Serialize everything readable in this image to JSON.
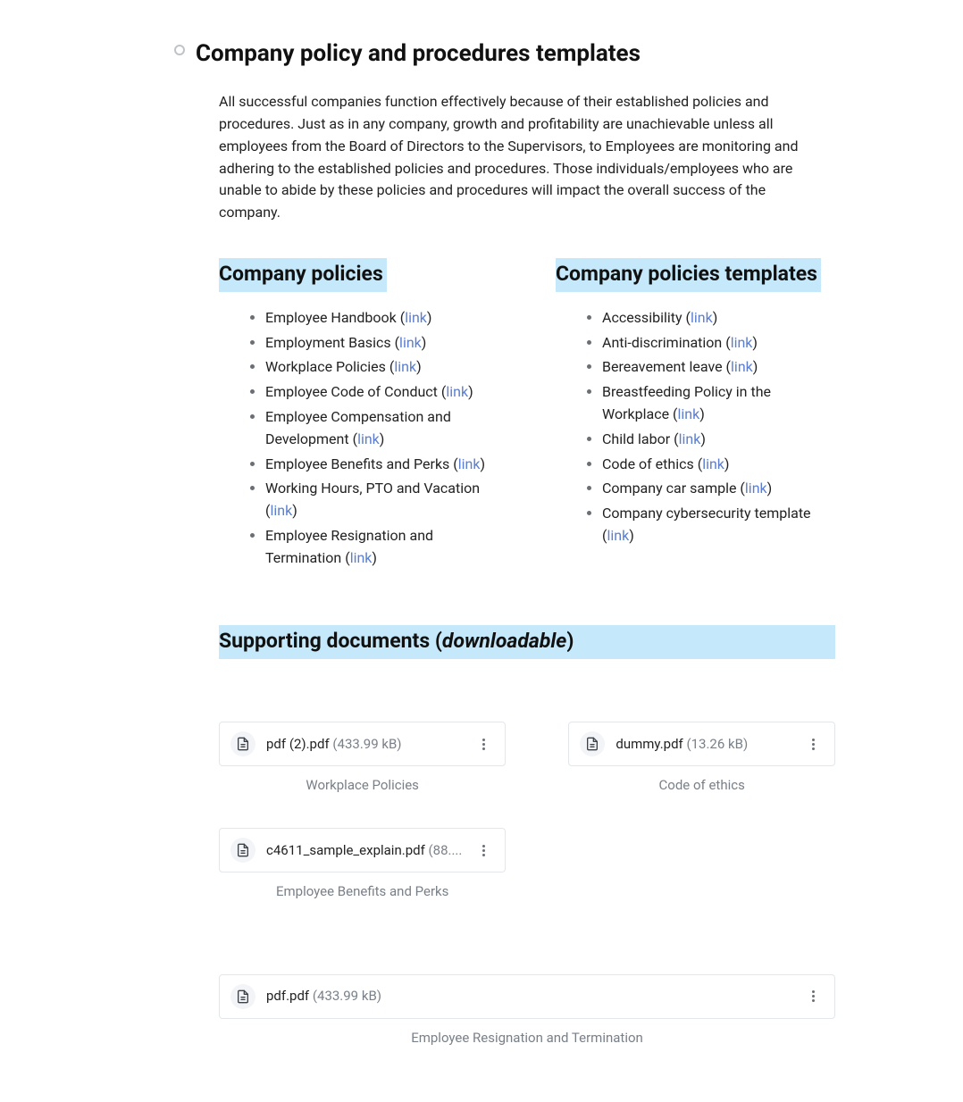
{
  "page": {
    "title": "Company policy and procedures templates",
    "intro": "All successful companies function effectively because of their established policies and procedures. Just as in any company, growth and profitability are unachievable unless all employees from the Board of Directors to the Supervisors, to Employees are monitoring and adhering to the established policies and procedures. Those individuals/employees who are unable to abide by these policies and procedures will impact the overall success of the company."
  },
  "policies_heading": "Company policies",
  "templates_heading": "Company policies templates",
  "supporting_heading_pre": "Supporting documents (",
  "supporting_heading_ital": "downloadable",
  "supporting_heading_post": ")",
  "link_label": "link",
  "policies": [
    {
      "label": "Employee Handbook"
    },
    {
      "label": "Employment Basics"
    },
    {
      "label": "Workplace Policies"
    },
    {
      "label": "Employee Code of Conduct"
    },
    {
      "label": "Employee Compensation and Development"
    },
    {
      "label": "Employee Benefits and Perks"
    },
    {
      "label": "Working Hours, PTO and Vacation"
    },
    {
      "label": "Employee Resignation and Termination"
    }
  ],
  "templates": [
    {
      "label": "Accessibility"
    },
    {
      "label": "Anti-discrimination"
    },
    {
      "label": "Bereavement leave"
    },
    {
      "label": "Breastfeeding Policy in the Workplace"
    },
    {
      "label": "Child labor"
    },
    {
      "label": "Code of ethics"
    },
    {
      "label": "Company car sample"
    },
    {
      "label": "Company cybersecurity template"
    }
  ],
  "files_grid": [
    {
      "name": "pdf (2).pdf",
      "size": "(433.99 kB)",
      "caption": "Workplace Policies"
    },
    {
      "name": "dummy.pdf",
      "size": "(13.26 kB)",
      "caption": "Code of ethics"
    },
    {
      "name": "c4611_sample_explain.pdf",
      "size": "(88....",
      "caption": "Employee Benefits and Perks"
    }
  ],
  "file_full": {
    "name": "pdf.pdf",
    "size": "(433.99 kB)",
    "caption": "Employee Resignation and Termination"
  }
}
